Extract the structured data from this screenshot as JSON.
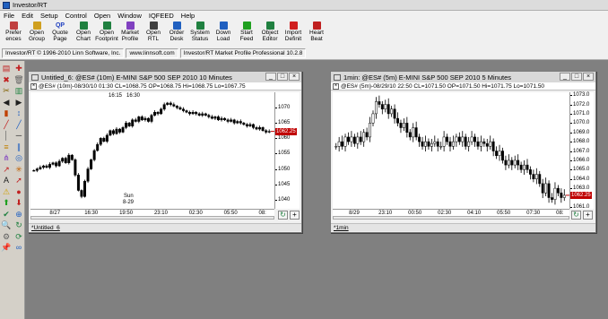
{
  "app": {
    "title": "Investor/RT"
  },
  "menu": [
    "File",
    "Edit",
    "Setup",
    "Control",
    "Open",
    "Window",
    "IQFEED",
    "Help"
  ],
  "toolbar": [
    {
      "l1": "Prefer",
      "l2": "ences",
      "icon": "preferences-icon",
      "color": "#c04040"
    },
    {
      "l1": "Open",
      "l2": "Group",
      "icon": "open-group-icon",
      "color": "#d0a020"
    },
    {
      "l1": "Quote",
      "l2": "Page",
      "icon": "quote-page-icon",
      "color": "#2040c0",
      "glyph": "QP"
    },
    {
      "l1": "Open",
      "l2": "Chart",
      "icon": "open-chart-icon",
      "color": "#208040"
    },
    {
      "l1": "Open",
      "l2": "Footprint",
      "icon": "open-footprint-icon",
      "color": "#208040"
    },
    {
      "l1": "Market",
      "l2": "Profile",
      "icon": "market-profile-icon",
      "color": "#8040c0"
    },
    {
      "l1": "Open",
      "l2": "RTL",
      "icon": "open-rtl-icon",
      "color": "#404040"
    },
    {
      "l1": "Order",
      "l2": "Desk",
      "icon": "order-desk-icon",
      "color": "#2060c0"
    },
    {
      "l1": "System",
      "l2": "Status",
      "icon": "system-status-icon",
      "color": "#208040"
    },
    {
      "l1": "Down",
      "l2": "Load",
      "icon": "download-icon",
      "color": "#2060c0"
    },
    {
      "l1": "Start",
      "l2": "Feed",
      "icon": "start-feed-icon",
      "color": "#20a020"
    },
    {
      "l1": "Object",
      "l2": "Editor",
      "icon": "object-editor-icon",
      "color": "#208040"
    },
    {
      "l1": "Import",
      "l2": "Definit",
      "icon": "import-definition-icon",
      "color": "#d02020"
    },
    {
      "l1": "Heart",
      "l2": "Beat",
      "icon": "heartbeat-icon",
      "color": "#c02020"
    }
  ],
  "status": {
    "copyright": "Investor/RT © 1996-2010 Linn Software, Inc.",
    "website": "www.linnsoft.com",
    "version": "Investor/RT Market Profile Professional 10.2.8"
  },
  "chart1": {
    "window_title": "Untitled_6: @ES# (10m) E-MINI S&P 500 SEP 2010 10 Minutes",
    "header": "@ES# (10m)-08/30/10 01:30 CL=1068.75 OP=1068.75 Hi=1068.75 Lo=1067.75",
    "tab": "*Untitled_6",
    "last_price": "1062.25",
    "annotations": [
      "16:15",
      "16:30",
      "Sun",
      "8-29"
    ],
    "price_ticks": [
      "1070",
      "1065",
      "1060",
      "1055",
      "1050",
      "1045",
      "1040"
    ],
    "time_ticks": [
      "8/27",
      "16:30",
      "19:50",
      "23:10",
      "02:30",
      "05:50",
      "08:"
    ],
    "colors": {
      "up": "#000000",
      "down": "#000000",
      "last": "#c00000"
    }
  },
  "chart2": {
    "window_title": "1min: @ES# (5m) E-MINI S&P 500 SEP 2010 5 Minutes",
    "header": "@ES# (5m)-08/29/10 22:50 CL=1071.50 OP=1071.50 Hi=1071.75 Lo=1071.50",
    "tab": "*1min",
    "last_price": "1062.25",
    "price_ticks": [
      "1073.0",
      "1072.0",
      "1071.0",
      "1070.0",
      "1069.0",
      "1068.0",
      "1067.0",
      "1066.0",
      "1065.0",
      "1064.0",
      "1063.0",
      "1062.0",
      "1061.0"
    ],
    "time_ticks": [
      "8/29",
      "23:10",
      "00:50",
      "02:30",
      "04:10",
      "05:50",
      "07:30",
      "08:"
    ],
    "colors": {
      "up": "#ffffff",
      "down": "#000000",
      "last": "#c00000"
    }
  },
  "chart_data": [
    {
      "type": "candlestick",
      "title": "@ES# (10m) E-MINI S&P 500 SEP 2010 10 Minutes",
      "ylim": [
        1037,
        1075
      ],
      "y_ticks": [
        1040,
        1045,
        1050,
        1055,
        1060,
        1065,
        1070
      ],
      "x_ticks": [
        "8/27",
        "16:30",
        "19:50",
        "23:10",
        "02:30",
        "05:50",
        "08:"
      ],
      "last": 1062.25,
      "close_path": [
        1049.5,
        1050.0,
        1050.5,
        1051.0,
        1050.5,
        1051.5,
        1052.0,
        1051.0,
        1052.5,
        1053.5,
        1052.0,
        1054.5,
        1053.0,
        1048.0,
        1043.0,
        1041.0,
        1046.0,
        1050.0,
        1053.0,
        1056.0,
        1058.0,
        1060.0,
        1059.0,
        1061.0,
        1062.5,
        1061.5,
        1063.0,
        1062.0,
        1063.5,
        1065.0,
        1064.0,
        1066.0,
        1065.5,
        1067.0,
        1066.0,
        1066.5,
        1065.5,
        1067.5,
        1068.5,
        1068.0,
        1069.5,
        1071.0,
        1071.5,
        1071.0,
        1070.5,
        1070.0,
        1069.5,
        1069.0,
        1068.5,
        1068.0,
        1068.5,
        1068.0,
        1067.5,
        1068.0,
        1067.5,
        1067.0,
        1066.5,
        1067.0,
        1066.0,
        1066.5,
        1066.0,
        1065.5,
        1066.0,
        1065.0,
        1065.5,
        1065.0,
        1064.5,
        1064.0,
        1064.5,
        1063.5,
        1063.0,
        1063.5,
        1062.5,
        1062.0,
        1062.25
      ]
    },
    {
      "type": "candlestick",
      "title": "@ES# (5m) E-MINI S&P 500 SEP 2010 5 Minutes",
      "ylim": [
        1060.8,
        1073.3
      ],
      "y_ticks": [
        1061,
        1062,
        1063,
        1064,
        1065,
        1066,
        1067,
        1068,
        1069,
        1070,
        1071,
        1072,
        1073
      ],
      "x_ticks": [
        "8/29",
        "23:10",
        "00:50",
        "02:30",
        "04:10",
        "05:50",
        "07:30",
        "08:"
      ],
      "last": 1062.25,
      "close_path": [
        1067.5,
        1068.0,
        1067.5,
        1068.5,
        1068.0,
        1068.5,
        1067.8,
        1068.5,
        1068.0,
        1069.0,
        1068.5,
        1070.0,
        1071.0,
        1072.3,
        1072.0,
        1071.5,
        1072.0,
        1071.0,
        1071.5,
        1070.5,
        1070.0,
        1069.5,
        1070.0,
        1069.0,
        1068.5,
        1069.5,
        1068.5,
        1068.0,
        1067.5,
        1068.0,
        1067.5,
        1067.8,
        1068.0,
        1067.5,
        1067.5,
        1068.5,
        1068.0,
        1067.5,
        1068.0,
        1068.5,
        1068.0,
        1068.5,
        1067.5,
        1068.0,
        1068.5,
        1068.0,
        1067.5,
        1068.0,
        1067.8,
        1067.5,
        1068.0,
        1067.0,
        1066.5,
        1067.0,
        1066.0,
        1065.5,
        1066.0,
        1065.5,
        1066.0,
        1065.5,
        1065.0,
        1065.5,
        1065.0,
        1064.5,
        1064.0,
        1064.5,
        1063.5,
        1062.5,
        1063.5,
        1062.0,
        1061.8,
        1063.0,
        1062.5,
        1062.0,
        1062.25
      ]
    }
  ],
  "left_tools": [
    "bar-chart-icon",
    "crosshair-icon",
    "delete-icon",
    "trash-icon",
    "cut-icon",
    "bars-icon",
    "arrow-left-icon",
    "arrow-right-icon",
    "candles-icon",
    "measure-icon",
    "line-icon",
    "line-icon",
    "vertical-line-icon",
    "horizontal-line-icon",
    "fib-icon",
    "channel-icon",
    "pitchfork-icon",
    "cycle-icon",
    "trend-icon",
    "gann-icon",
    "text-icon",
    "arrow-icon",
    "alert-icon",
    "marker-icon",
    "buy-icon",
    "sell-icon",
    "check-icon",
    "zoom-icon",
    "magnify-icon",
    "sync-icon",
    "settings-icon",
    "refresh-icon",
    "pin-icon",
    "link-icon"
  ]
}
